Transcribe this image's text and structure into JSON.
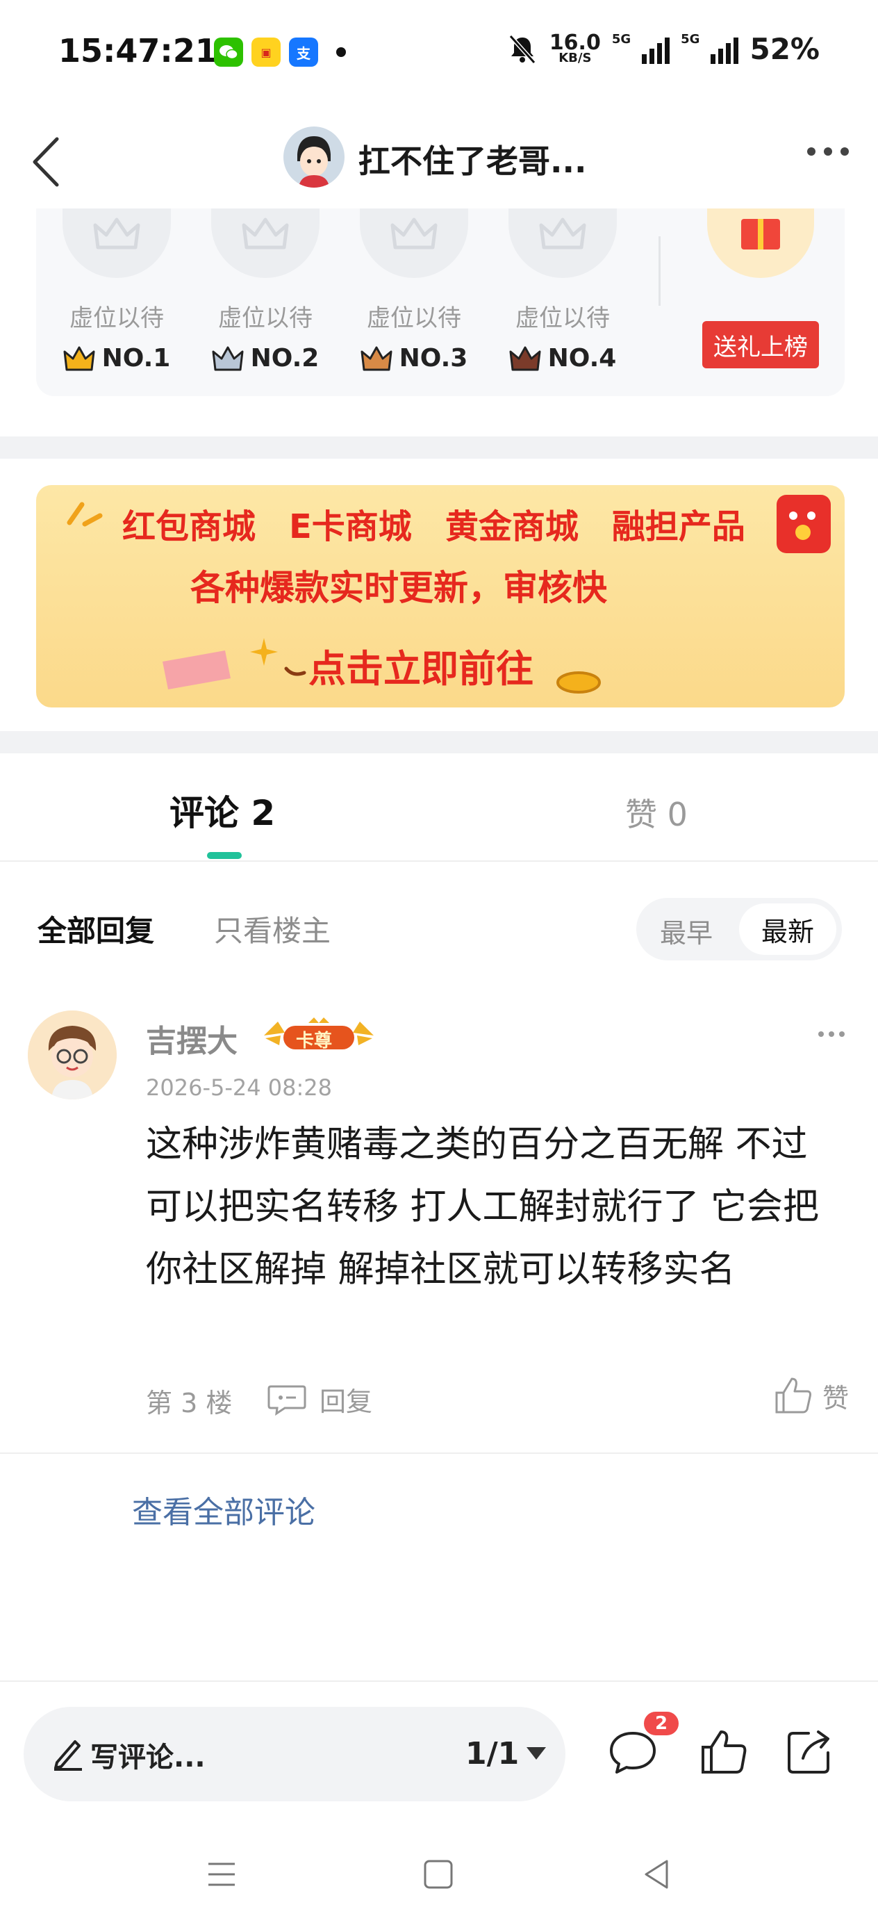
{
  "status_bar": {
    "time": "15:47:21",
    "net_speed_value": "16.0",
    "net_speed_unit": "KB/S",
    "signal_tag": "5G",
    "battery": "52%",
    "icons": [
      "wechat-icon",
      "app-icon",
      "alipay-icon",
      "dot-icon",
      "mute-icon",
      "signal-icon",
      "signal-icon"
    ]
  },
  "header": {
    "title": "扛不住了老哥...",
    "back_icon": "back-icon",
    "more_icon": "more-icon"
  },
  "rank": {
    "seats": [
      {
        "label": "虚位以待",
        "rank": "NO.1",
        "crown_color": "#f3b21b"
      },
      {
        "label": "虚位以待",
        "rank": "NO.2",
        "crown_color": "#8fa3bd"
      },
      {
        "label": "虚位以待",
        "rank": "NO.3",
        "crown_color": "#c97a3a"
      },
      {
        "label": "虚位以待",
        "rank": "NO.4",
        "crown_color": "#7b3b2a"
      }
    ],
    "gift_button": "送礼上榜"
  },
  "banner": {
    "line1": [
      "红包商城",
      "E卡商城",
      "黄金商城",
      "融担产品"
    ],
    "line2": "各种爆款实时更新，审核快",
    "line3": "点击立即前往"
  },
  "tabs": {
    "comments": "评论 2",
    "likes": "赞 0"
  },
  "filter": {
    "all": "全部回复",
    "op_only": "只看楼主",
    "sort_early": "最早",
    "sort_new": "最新"
  },
  "comment": {
    "username": "吉摆大",
    "badge": "卡尊",
    "date": "2026-5-24 08:28",
    "text": "这种涉炸黄赌毒之类的百分之百无解 不过可以把实名转移 打人工解封就行了 它会把你社区解掉 解掉社区就可以转移实名",
    "floor": "第 3 楼",
    "reply": "回复",
    "like": "赞"
  },
  "view_all": "查看全部评论",
  "bottom_bar": {
    "write_comment": "写评论...",
    "page": "1/1",
    "badge_count": "2"
  },
  "colors": {
    "accent_green": "#20c29a",
    "gift_red": "#e73b35",
    "link_blue": "#4a6fa5",
    "badge_red": "#f04a4a"
  }
}
